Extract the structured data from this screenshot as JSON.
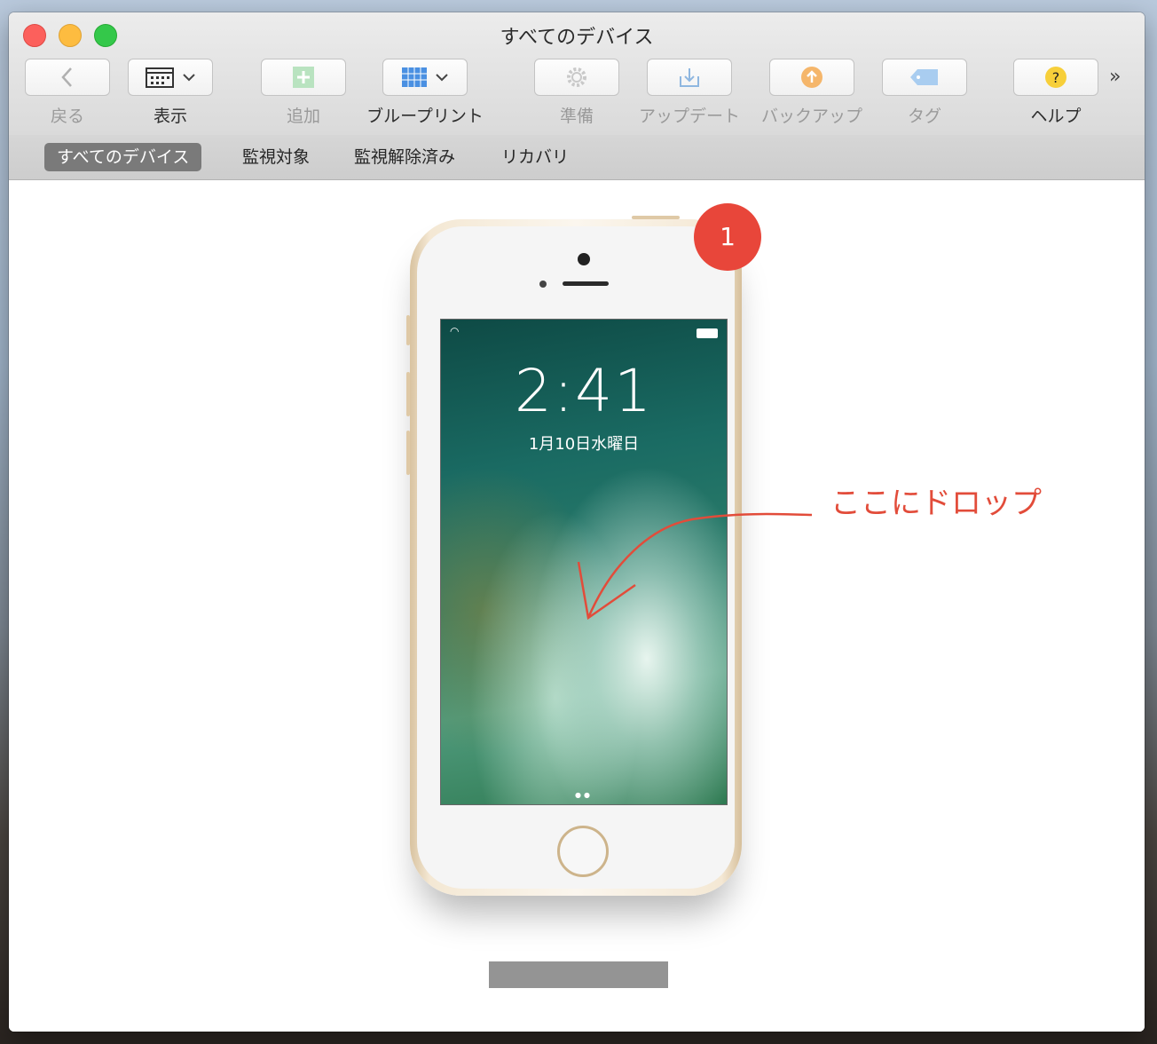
{
  "window": {
    "title": "すべてのデバイス"
  },
  "toolbar": {
    "items": [
      {
        "label": "戻る",
        "icon": "chevron-left-icon"
      },
      {
        "label": "表示",
        "icon": "calendar-grid-icon"
      },
      {
        "label": "追加",
        "icon": "plus-icon"
      },
      {
        "label": "ブループリント",
        "icon": "blueprint-grid-icon"
      },
      {
        "label": "準備",
        "icon": "gear-icon"
      },
      {
        "label": "アップデート",
        "icon": "download-tray-icon"
      },
      {
        "label": "バックアップ",
        "icon": "upload-circle-icon"
      },
      {
        "label": "タグ",
        "icon": "tag-icon"
      },
      {
        "label": "ヘルプ",
        "icon": "help-icon"
      }
    ],
    "overflow": "»"
  },
  "tabs": [
    {
      "label": "すべてのデバイス",
      "active": true
    },
    {
      "label": "監視対象",
      "active": false
    },
    {
      "label": "監視解除済み",
      "active": false
    },
    {
      "label": "リカバリ",
      "active": false
    }
  ],
  "device": {
    "badge": "1",
    "lock_time": "2:41",
    "lock_date": "1月10日水曜日"
  },
  "annotation": {
    "label": "ここにドロップ",
    "color": "#e24c3a"
  }
}
